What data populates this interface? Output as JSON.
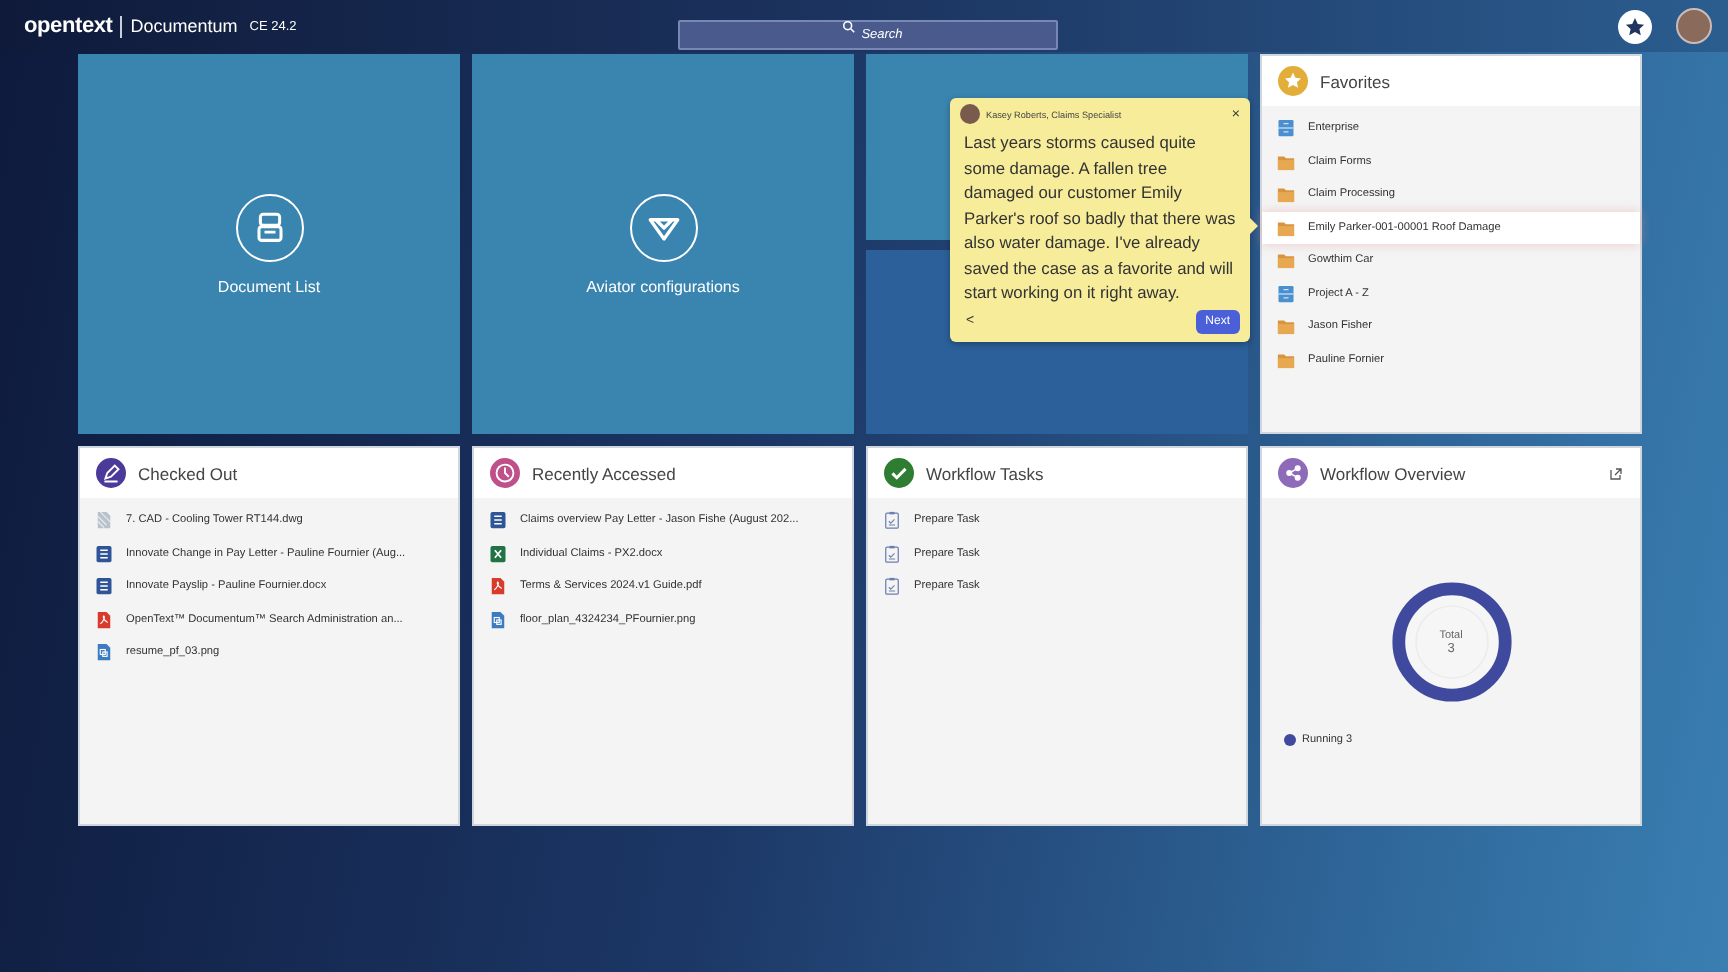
{
  "header": {
    "brand": "opentext",
    "product": "Documentum",
    "version": "CE 24.2",
    "search": {
      "placeholder": "Search"
    }
  },
  "tiles": [
    {
      "kind": "document-list",
      "label": "Document List"
    },
    {
      "kind": "aviator",
      "label": "Aviator configurations"
    }
  ],
  "tooltip": {
    "author": "Kasey Roberts, Claims Specialist",
    "body": "Last years storms caused quite some damage. A fallen tree damaged our customer Emily Parker's roof so badly that there was also water damage. I've already saved the case as a favorite and will start working on it right away.",
    "close": "×",
    "back": "<",
    "next": "Next"
  },
  "favorites": {
    "title": "Favorites",
    "items": [
      {
        "kind": "cabinet",
        "label": "Enterprise",
        "highlighted": false
      },
      {
        "kind": "folder",
        "label": "Claim Forms",
        "highlighted": false
      },
      {
        "kind": "folder",
        "label": "Claim Processing",
        "highlighted": false
      },
      {
        "kind": "folder",
        "label": "Emily Parker-001-00001 Roof Damage",
        "highlighted": true
      },
      {
        "kind": "folder",
        "label": "Gowthim Car",
        "highlighted": false
      },
      {
        "kind": "cabinet",
        "label": "Project A - Z",
        "highlighted": false
      },
      {
        "kind": "folder",
        "label": "Jason Fisher",
        "highlighted": false
      },
      {
        "kind": "folder",
        "label": "Pauline Fornier",
        "highlighted": false
      }
    ]
  },
  "checked_out": {
    "title": "Checked Out",
    "items": [
      {
        "kind": "cad",
        "label": "7. CAD - Cooling Tower RT144.dwg"
      },
      {
        "kind": "word",
        "label": "Innovate Change in Pay Letter - Pauline Fournier (Aug..."
      },
      {
        "kind": "word",
        "label": "Innovate Payslip - Pauline Fournier.docx"
      },
      {
        "kind": "pdf",
        "label": "OpenText™ Documentum™ Search Administration an..."
      },
      {
        "kind": "image",
        "label": "resume_pf_03.png"
      }
    ]
  },
  "recently_accessed": {
    "title": "Recently Accessed",
    "items": [
      {
        "kind": "word",
        "label": "Claims overview Pay Letter - Jason Fishe (August 202..."
      },
      {
        "kind": "excel",
        "label": "Individual Claims - PX2.docx"
      },
      {
        "kind": "pdf",
        "label": "Terms & Services 2024.v1 Guide.pdf"
      },
      {
        "kind": "image",
        "label": "floor_plan_4324234_PFournier.png"
      }
    ]
  },
  "workflow_tasks": {
    "title": "Workflow Tasks",
    "items": [
      {
        "label": "Prepare Task"
      },
      {
        "label": "Prepare Task"
      },
      {
        "label": "Prepare Task"
      }
    ]
  },
  "workflow_overview": {
    "title": "Workflow Overview",
    "center_label": "Total",
    "center_value": "3",
    "legend": [
      {
        "label": "Running 3",
        "color": "#3f4a9e"
      }
    ]
  }
}
